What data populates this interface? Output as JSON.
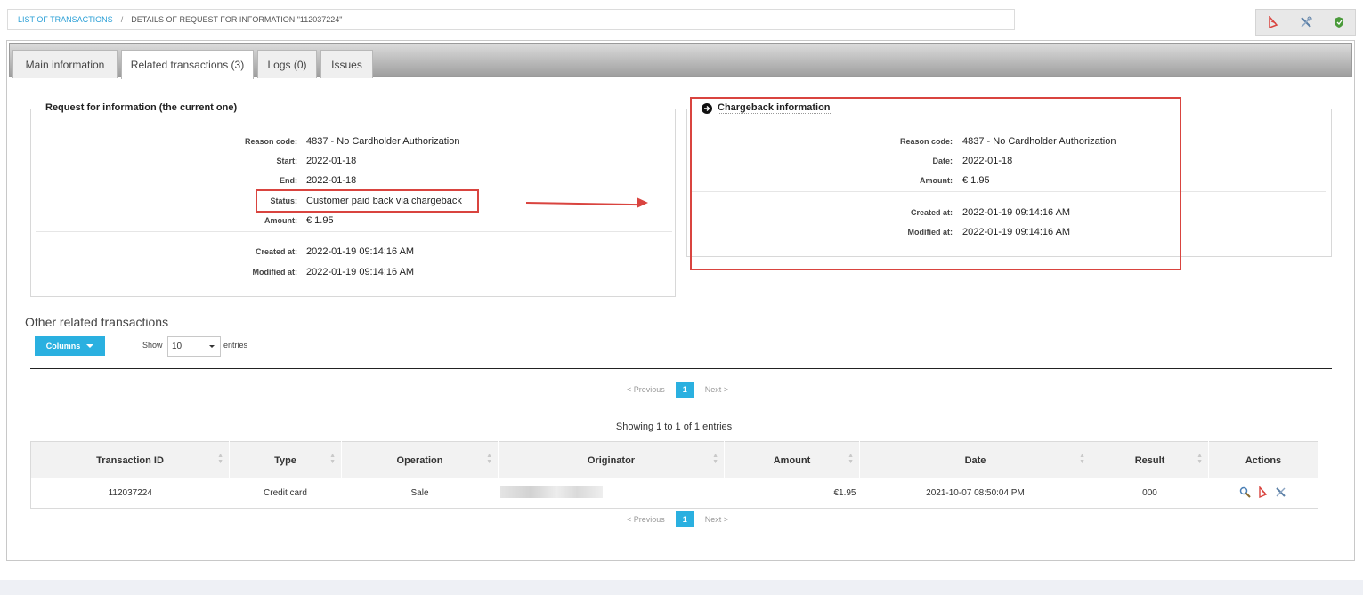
{
  "breadcrumb": {
    "link": "LIST OF TRANSACTIONS",
    "separator": "/",
    "current": "DETAILS OF REQUEST FOR INFORMATION \"112037224\""
  },
  "top_actions": [
    "pdf-icon",
    "tools-icon",
    "shield-icon"
  ],
  "tabs": [
    {
      "label": "Main information"
    },
    {
      "label": "Related transactions (3)",
      "active": true
    },
    {
      "label": "Logs (0)"
    },
    {
      "label": "Issues"
    }
  ],
  "rfi": {
    "legend": "Request for information (the current one)",
    "fields": [
      {
        "label": "Reason code:",
        "value": "4837 - No Cardholder Authorization"
      },
      {
        "label": "Start:",
        "value": "2022-01-18"
      },
      {
        "label": "End:",
        "value": "2022-01-18"
      },
      {
        "label": "Status:",
        "value": "Customer paid back via chargeback"
      },
      {
        "label": "Amount:",
        "value": "€ 1.95"
      }
    ],
    "meta": [
      {
        "label": "Created at:",
        "value": "2022-01-19 09:14:16 AM"
      },
      {
        "label": "Modified at:",
        "value": "2022-01-19 09:14:16 AM"
      }
    ]
  },
  "chargeback": {
    "legend": "Chargeback information",
    "fields": [
      {
        "label": "Reason code:",
        "value": "4837 - No Cardholder Authorization"
      },
      {
        "label": "Date:",
        "value": "2022-01-18"
      },
      {
        "label": "Amount:",
        "value": "€ 1.95"
      }
    ],
    "meta": [
      {
        "label": "Created at:",
        "value": "2022-01-19 09:14:16 AM"
      },
      {
        "label": "Modified at:",
        "value": "2022-01-19 09:14:16 AM"
      }
    ]
  },
  "other": {
    "title": "Other related transactions",
    "columns_button": "Columns",
    "show_label": "Show",
    "show_value": "10",
    "entries_label": "entries",
    "pager": {
      "previous": "< Previous",
      "page": "1",
      "next": "Next >"
    },
    "showing": "Showing 1 to 1 of 1 entries",
    "table": {
      "headers": [
        "Transaction ID",
        "Type",
        "Operation",
        "Originator",
        "Amount",
        "Date",
        "Result",
        "Actions"
      ],
      "rows": [
        {
          "transaction_id": "112037224",
          "type": "Credit card",
          "operation": "Sale",
          "originator": "",
          "amount": "€1.95",
          "date": "2021-10-07 08:50:04 PM",
          "result": "000",
          "actions": [
            "search-icon",
            "pdf-icon",
            "tools-icon"
          ]
        }
      ]
    }
  },
  "annotation_color": "#d9443f",
  "accent_color": "#2ab0e0"
}
